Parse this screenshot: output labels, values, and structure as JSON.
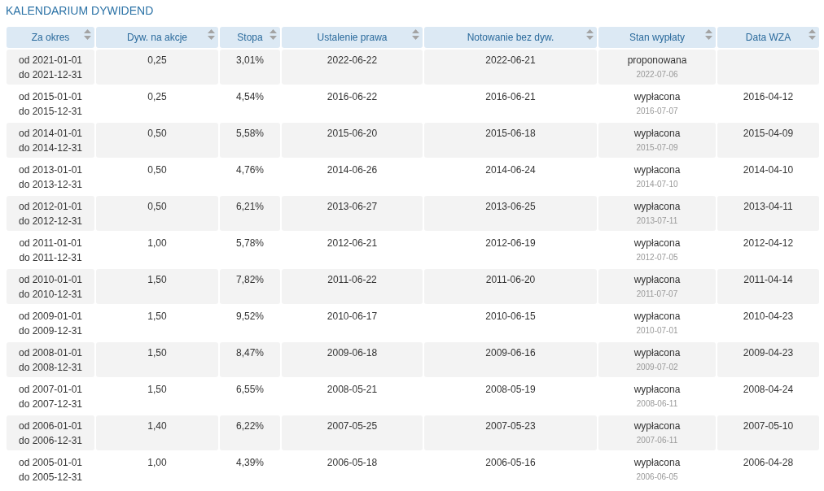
{
  "title": "KALENDARIUM DYWIDEND",
  "table": {
    "columns": [
      "Za okres",
      "Dyw. na akcje",
      "Stopa",
      "Ustalenie prawa",
      "Notowanie bez dyw.",
      "Stan wypłaty",
      "Data WZA"
    ],
    "rows": [
      {
        "period_from": "od 2021-01-01",
        "period_to": "do 2021-12-31",
        "dividend": "0,25",
        "rate": "3,01%",
        "record_date": "2022-06-22",
        "ex_date": "2022-06-21",
        "status": "proponowana",
        "payment_date": "2022-07-06"
      },
      {
        "period_from": "od 2015-01-01",
        "period_to": "do 2015-12-31",
        "dividend": "0,25",
        "rate": "4,54%",
        "record_date": "2016-06-22",
        "ex_date": "2016-06-21",
        "status": "wypłacona",
        "payment_date": "2016-07-07",
        "agm_date": "2016-04-12"
      },
      {
        "period_from": "od 2014-01-01",
        "period_to": "do 2014-12-31",
        "dividend": "0,50",
        "rate": "5,58%",
        "record_date": "2015-06-20",
        "ex_date": "2015-06-18",
        "status": "wypłacona",
        "payment_date": "2015-07-09",
        "agm_date": "2015-04-09"
      },
      {
        "period_from": "od 2013-01-01",
        "period_to": "do 2013-12-31",
        "dividend": "0,50",
        "rate": "4,76%",
        "record_date": "2014-06-26",
        "ex_date": "2014-06-24",
        "status": "wypłacona",
        "payment_date": "2014-07-10",
        "agm_date": "2014-04-10"
      },
      {
        "period_from": "od 2012-01-01",
        "period_to": "do 2012-12-31",
        "dividend": "0,50",
        "rate": "6,21%",
        "record_date": "2013-06-27",
        "ex_date": "2013-06-25",
        "status": "wypłacona",
        "payment_date": "2013-07-11",
        "agm_date": "2013-04-11"
      },
      {
        "period_from": "od 2011-01-01",
        "period_to": "do 2011-12-31",
        "dividend": "1,00",
        "rate": "5,78%",
        "record_date": "2012-06-21",
        "ex_date": "2012-06-19",
        "status": "wypłacona",
        "payment_date": "2012-07-05",
        "agm_date": "2012-04-12"
      },
      {
        "period_from": "od 2010-01-01",
        "period_to": "do 2010-12-31",
        "dividend": "1,50",
        "rate": "7,82%",
        "record_date": "2011-06-22",
        "ex_date": "2011-06-20",
        "status": "wypłacona",
        "payment_date": "2011-07-07",
        "agm_date": "2011-04-14"
      },
      {
        "period_from": "od 2009-01-01",
        "period_to": "do 2009-12-31",
        "dividend": "1,50",
        "rate": "9,52%",
        "record_date": "2010-06-17",
        "ex_date": "2010-06-15",
        "status": "wypłacona",
        "payment_date": "2010-07-01",
        "agm_date": "2010-04-23"
      },
      {
        "period_from": "od 2008-01-01",
        "period_to": "do 2008-12-31",
        "dividend": "1,50",
        "rate": "8,47%",
        "record_date": "2009-06-18",
        "ex_date": "2009-06-16",
        "status": "wypłacona",
        "payment_date": "2009-07-02",
        "agm_date": "2009-04-23"
      },
      {
        "period_from": "od 2007-01-01",
        "period_to": "do 2007-12-31",
        "dividend": "1,50",
        "rate": "6,55%",
        "record_date": "2008-05-21",
        "ex_date": "2008-05-19",
        "status": "wypłacona",
        "payment_date": "2008-06-11",
        "agm_date": "2008-04-24"
      },
      {
        "period_from": "od 2006-01-01",
        "period_to": "do 2006-12-31",
        "dividend": "1,40",
        "rate": "6,22%",
        "record_date": "2007-05-25",
        "ex_date": "2007-05-23",
        "status": "wypłacona",
        "payment_date": "2007-06-11",
        "agm_date": "2007-05-10"
      },
      {
        "period_from": "od 2005-01-01",
        "period_to": "do 2005-12-31",
        "dividend": "1,00",
        "rate": "4,39%",
        "record_date": "2006-05-18",
        "ex_date": "2006-05-16",
        "status": "wypłacona",
        "payment_date": "2006-06-05",
        "agm_date": "2006-04-28"
      }
    ]
  }
}
